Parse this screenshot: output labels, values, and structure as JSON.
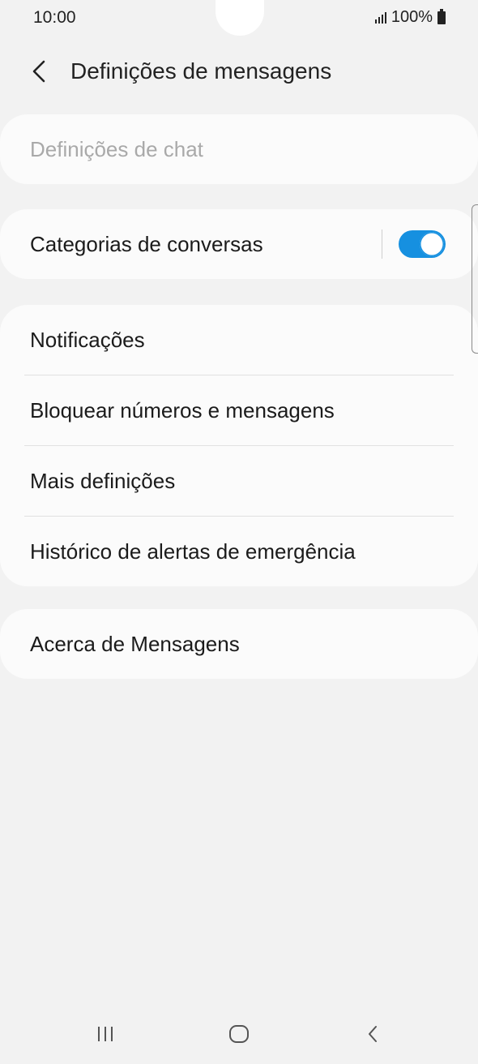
{
  "status_bar": {
    "time": "10:00",
    "battery_text": "100%",
    "signal_icon": "signal-bars-icon",
    "battery_icon": "battery-icon"
  },
  "header": {
    "title": "Definições de mensagens",
    "back_icon": "chevron-left-icon"
  },
  "sections": {
    "chat_settings": {
      "label": "Definições de chat",
      "enabled": false
    },
    "conversation_categories": {
      "label": "Categorias de conversas",
      "toggle_on": true
    },
    "group": {
      "items": [
        {
          "label": "Notificações"
        },
        {
          "label": "Bloquear números e mensagens"
        },
        {
          "label": "Mais definições"
        },
        {
          "label": "Histórico de alertas de emergência"
        }
      ]
    },
    "about": {
      "label": "Acerca de Mensagens"
    }
  },
  "nav_bar": {
    "recents_icon": "recents-icon",
    "home_icon": "home-icon",
    "back_icon": "back-icon"
  },
  "colors": {
    "background": "#f2f2f2",
    "card": "#fbfbfb",
    "accent": "#1690e0",
    "disabled_text": "#a9a9a9"
  }
}
